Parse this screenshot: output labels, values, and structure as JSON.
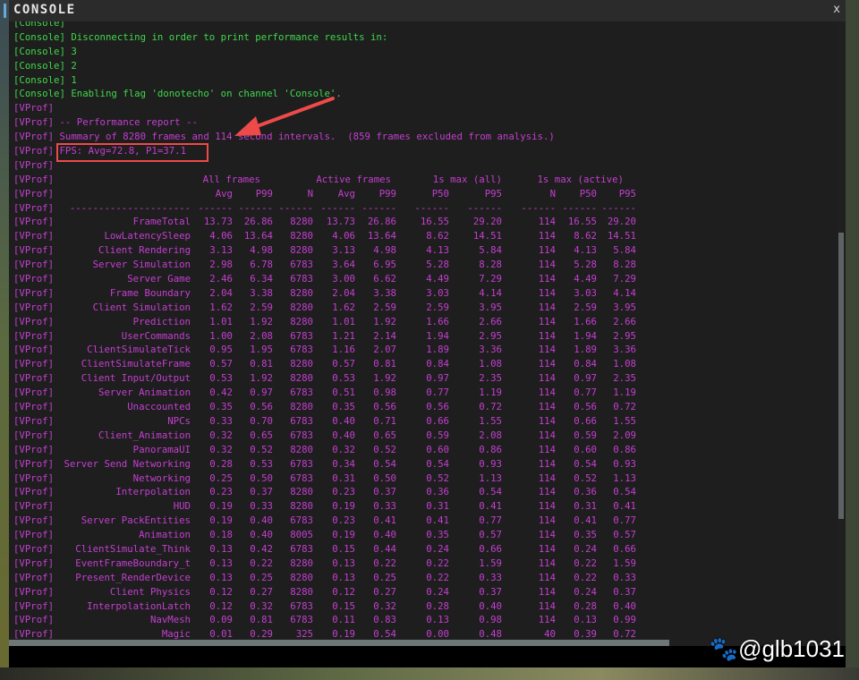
{
  "window": {
    "title": "CONSOLE",
    "close_label": "x"
  },
  "console_lines": [
    {
      "prefix": "[Console]",
      "text": "",
      "color": "green"
    },
    {
      "prefix": "[Console]",
      "text": " Disconnecting in order to print performance results in:",
      "color": "green"
    },
    {
      "prefix": "[Console]",
      "text": " 3",
      "color": "green"
    },
    {
      "prefix": "[Console]",
      "text": " 2",
      "color": "green"
    },
    {
      "prefix": "[Console]",
      "text": " 1",
      "color": "green"
    },
    {
      "prefix": "[Console]",
      "text": " Enabling flag 'donotecho' on channel 'Console'.",
      "color": "green"
    },
    {
      "prefix": "[VProf]",
      "text": "",
      "color": "mag"
    },
    {
      "prefix": "[VProf]",
      "text": " -- Performance report --",
      "color": "mag"
    },
    {
      "prefix": "[VProf]",
      "text": " Summary of 8280 frames and 114 second intervals.  (859 frames excluded from analysis.)",
      "color": "mag"
    },
    {
      "prefix": "[VProf]",
      "text": " FPS: Avg=72.8, P1=37.1",
      "color": "mag"
    },
    {
      "prefix": "[VProf]",
      "text": "",
      "color": "mag"
    }
  ],
  "table": {
    "prefix": "[VProf]",
    "group_headers": [
      "All frames",
      "Active frames",
      "1s max (all)",
      "1s max (active)"
    ],
    "columns": [
      "Avg",
      "P99",
      "N",
      "Avg",
      "P99",
      "P50",
      "P95",
      "N",
      "P50",
      "P95"
    ],
    "dash_name": "---------------------",
    "dash_col": "------",
    "rows": [
      [
        "FrameTotal",
        "13.73",
        "26.86",
        "8280",
        "13.73",
        "26.86",
        "16.55",
        "29.20",
        "114",
        "16.55",
        "29.20"
      ],
      [
        "LowLatencySleep",
        "4.06",
        "13.64",
        "8280",
        "4.06",
        "13.64",
        "8.62",
        "14.51",
        "114",
        "8.62",
        "14.51"
      ],
      [
        "Client Rendering",
        "3.13",
        "4.98",
        "8280",
        "3.13",
        "4.98",
        "4.13",
        "5.84",
        "114",
        "4.13",
        "5.84"
      ],
      [
        "Server Simulation",
        "2.98",
        "6.78",
        "6783",
        "3.64",
        "6.95",
        "5.28",
        "8.28",
        "114",
        "5.28",
        "8.28"
      ],
      [
        "Server Game",
        "2.46",
        "6.34",
        "6783",
        "3.00",
        "6.62",
        "4.49",
        "7.29",
        "114",
        "4.49",
        "7.29"
      ],
      [
        "Frame Boundary",
        "2.04",
        "3.38",
        "8280",
        "2.04",
        "3.38",
        "3.03",
        "4.14",
        "114",
        "3.03",
        "4.14"
      ],
      [
        "Client Simulation",
        "1.62",
        "2.59",
        "8280",
        "1.62",
        "2.59",
        "2.59",
        "3.95",
        "114",
        "2.59",
        "3.95"
      ],
      [
        "Prediction",
        "1.01",
        "1.92",
        "8280",
        "1.01",
        "1.92",
        "1.66",
        "2.66",
        "114",
        "1.66",
        "2.66"
      ],
      [
        "UserCommands",
        "1.00",
        "2.08",
        "6783",
        "1.21",
        "2.14",
        "1.94",
        "2.95",
        "114",
        "1.94",
        "2.95"
      ],
      [
        "ClientSimulateTick",
        "0.95",
        "1.95",
        "6783",
        "1.16",
        "2.07",
        "1.89",
        "3.36",
        "114",
        "1.89",
        "3.36"
      ],
      [
        "ClientSimulateFrame",
        "0.57",
        "0.81",
        "8280",
        "0.57",
        "0.81",
        "0.84",
        "1.08",
        "114",
        "0.84",
        "1.08"
      ],
      [
        "Client Input/Output",
        "0.53",
        "1.92",
        "8280",
        "0.53",
        "1.92",
        "0.97",
        "2.35",
        "114",
        "0.97",
        "2.35"
      ],
      [
        "Server Animation",
        "0.42",
        "0.97",
        "6783",
        "0.51",
        "0.98",
        "0.77",
        "1.19",
        "114",
        "0.77",
        "1.19"
      ],
      [
        "Unaccounted",
        "0.35",
        "0.56",
        "8280",
        "0.35",
        "0.56",
        "0.56",
        "0.72",
        "114",
        "0.56",
        "0.72"
      ],
      [
        "NPCs",
        "0.33",
        "0.70",
        "6783",
        "0.40",
        "0.71",
        "0.66",
        "1.55",
        "114",
        "0.66",
        "1.55"
      ],
      [
        "Client_Animation",
        "0.32",
        "0.65",
        "6783",
        "0.40",
        "0.65",
        "0.59",
        "2.08",
        "114",
        "0.59",
        "2.09"
      ],
      [
        "PanoramaUI",
        "0.32",
        "0.52",
        "8280",
        "0.32",
        "0.52",
        "0.60",
        "0.86",
        "114",
        "0.60",
        "0.86"
      ],
      [
        "Server Send Networking",
        "0.28",
        "0.53",
        "6783",
        "0.34",
        "0.54",
        "0.54",
        "0.93",
        "114",
        "0.54",
        "0.93"
      ],
      [
        "Networking",
        "0.25",
        "0.50",
        "6783",
        "0.31",
        "0.50",
        "0.52",
        "1.13",
        "114",
        "0.52",
        "1.13"
      ],
      [
        "Interpolation",
        "0.23",
        "0.37",
        "8280",
        "0.23",
        "0.37",
        "0.36",
        "0.54",
        "114",
        "0.36",
        "0.54"
      ],
      [
        "HUD",
        "0.19",
        "0.33",
        "8280",
        "0.19",
        "0.33",
        "0.31",
        "0.41",
        "114",
        "0.31",
        "0.41"
      ],
      [
        "Server PackEntities",
        "0.19",
        "0.40",
        "6783",
        "0.23",
        "0.41",
        "0.41",
        "0.77",
        "114",
        "0.41",
        "0.77"
      ],
      [
        "Animation",
        "0.18",
        "0.40",
        "8005",
        "0.19",
        "0.40",
        "0.35",
        "0.57",
        "114",
        "0.35",
        "0.57"
      ],
      [
        "ClientSimulate_Think",
        "0.13",
        "0.42",
        "6783",
        "0.15",
        "0.44",
        "0.24",
        "0.66",
        "114",
        "0.24",
        "0.66"
      ],
      [
        "EventFrameBoundary_t",
        "0.13",
        "0.22",
        "8280",
        "0.13",
        "0.22",
        "0.22",
        "1.59",
        "114",
        "0.22",
        "1.59"
      ],
      [
        "Present_RenderDevice",
        "0.13",
        "0.25",
        "8280",
        "0.13",
        "0.25",
        "0.22",
        "0.33",
        "114",
        "0.22",
        "0.33"
      ],
      [
        "Client Physics",
        "0.12",
        "0.27",
        "8280",
        "0.12",
        "0.27",
        "0.24",
        "0.37",
        "114",
        "0.24",
        "0.37"
      ],
      [
        "InterpolationLatch",
        "0.12",
        "0.32",
        "6783",
        "0.15",
        "0.32",
        "0.28",
        "0.40",
        "114",
        "0.28",
        "0.40"
      ],
      [
        "NavMesh",
        "0.09",
        "0.81",
        "6783",
        "0.11",
        "0.83",
        "0.13",
        "0.98",
        "114",
        "0.13",
        "0.99"
      ],
      [
        "Magic",
        "0.01",
        "0.29",
        "325",
        "0.19",
        "0.54",
        "0.00",
        "0.48",
        "40",
        "0.39",
        "0.72"
      ]
    ]
  },
  "watermark": "@glb1031",
  "colors": {
    "green": "#3fd84a",
    "magenta": "#c43fd0",
    "annotation": "#ee4a4a"
  }
}
